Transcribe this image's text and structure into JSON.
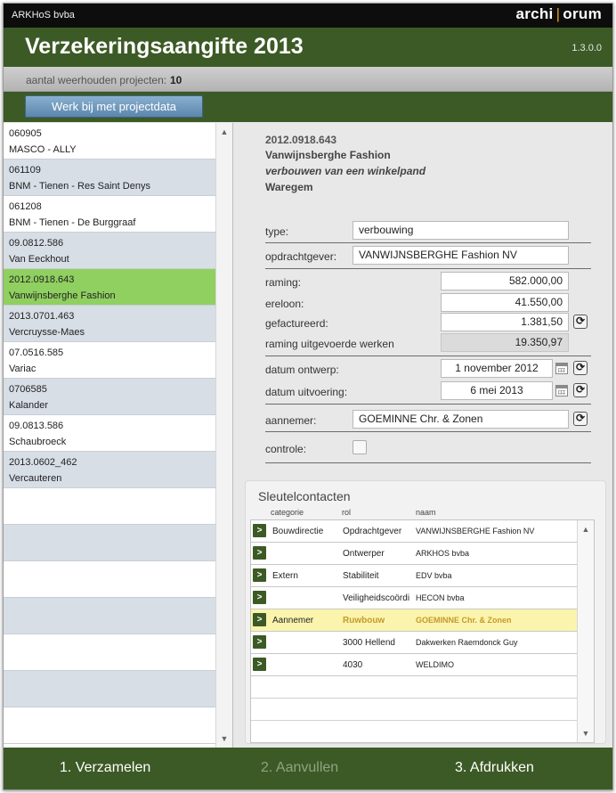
{
  "app": {
    "company": "ARKHoS bvba",
    "logo_left": "archi",
    "logo_sep": "|",
    "logo_right": "orum",
    "title": "Verzekeringsaangifte 2013",
    "version": "1.3.0.0"
  },
  "status": {
    "label": "aantal weerhouden projecten:",
    "value": "10"
  },
  "toolbar": {
    "update_label": "Werk bij met projectdata"
  },
  "projects": [
    {
      "code": "060905",
      "name": "MASCO - ALLY"
    },
    {
      "code": "061109",
      "name": "BNM - Tienen - Res Saint Denys"
    },
    {
      "code": "061208",
      "name": "BNM - Tienen - De Burggraaf"
    },
    {
      "code": "09.0812.586",
      "name": "Van Eeckhout"
    },
    {
      "code": "2012.0918.643",
      "name": "Vanwijnsberghe Fashion"
    },
    {
      "code": "2013.0701.463",
      "name": "Vercruysse-Maes"
    },
    {
      "code": "07.0516.585",
      "name": "Variac"
    },
    {
      "code": "0706585",
      "name": "Kalander"
    },
    {
      "code": "09.0813.586",
      "name": "Schaubroeck"
    },
    {
      "code": "2013.0602_462",
      "name": "Vercauteren"
    }
  ],
  "selected_project_index": 4,
  "detail": {
    "code": "2012.0918.643",
    "client": "Vanwijnsberghe Fashion",
    "description": "verbouwen van een winkelpand",
    "city": "Waregem",
    "fields": {
      "type": {
        "label": "type:",
        "value": "verbouwing"
      },
      "opdrachtgever": {
        "label": "opdrachtgever:",
        "value": "VANWIJNSBERGHE Fashion NV"
      },
      "raming": {
        "label": "raming:",
        "value": "582.000,00"
      },
      "ereloon": {
        "label": "ereloon:",
        "value": "41.550,00"
      },
      "gefactureerd": {
        "label": "gefactureerd:",
        "value": "1.381,50"
      },
      "raming_uitgevoerd": {
        "label": "raming uitgevoerde werken",
        "value": "19.350,97"
      },
      "datum_ontwerp": {
        "label": "datum ontwerp:",
        "value": "1 november 2012"
      },
      "datum_uitvoering": {
        "label": "datum uitvoering:",
        "value": "6 mei 2013"
      },
      "aannemer": {
        "label": "aannemer:",
        "value": "GOEMINNE Chr. & Zonen"
      },
      "controle": {
        "label": "controle:",
        "checked": false
      }
    }
  },
  "contacts": {
    "title": "Sleutelcontacten",
    "columns": {
      "categorie": "categorie",
      "rol": "rol",
      "naam": "naam"
    },
    "go_symbol": ">",
    "rows": [
      {
        "categorie": "Bouwdirectie",
        "rol": "Opdrachtgever",
        "naam": "VANWIJNSBERGHE Fashion NV",
        "highlight": false
      },
      {
        "categorie": "",
        "rol": "Ontwerper",
        "naam": "ARKHOS bvba",
        "highlight": false
      },
      {
        "categorie": "Extern",
        "rol": "Stabiliteit",
        "naam": "EDV bvba",
        "highlight": false
      },
      {
        "categorie": "",
        "rol": "Veiligheidscoördi",
        "naam": "HECON bvba",
        "highlight": false
      },
      {
        "categorie": "Aannemer",
        "rol": "Ruwbouw",
        "naam": "GOEMINNE Chr. & Zonen",
        "highlight": true
      },
      {
        "categorie": "",
        "rol": "3000 Hellend",
        "naam": "Dakwerken  Raemdonck Guy",
        "highlight": false
      },
      {
        "categorie": "",
        "rol": "4030",
        "naam": "WELDIMO",
        "highlight": false
      }
    ]
  },
  "footer": {
    "steps": [
      {
        "label": "1. Verzamelen",
        "enabled": true
      },
      {
        "label": "2. Aanvullen",
        "enabled": false
      },
      {
        "label": "3. Afdrukken",
        "enabled": true
      }
    ]
  },
  "icons": {
    "scroll_up": "▲",
    "scroll_down": "▼",
    "refresh": "⟳"
  },
  "colors": {
    "header_green": "#3c5a25",
    "selected_green": "#8fd060",
    "alt_row": "#d8dee6",
    "highlight_row": "#fbf4ad",
    "button_blue": "#6b93b8"
  }
}
